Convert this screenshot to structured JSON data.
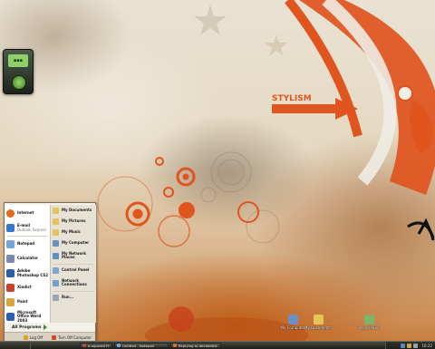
{
  "colors": {
    "accent": "#e0541e",
    "taskbar": "#2a2a25",
    "menu_bg": "#f4f1ea"
  },
  "wallpaper": {
    "text": "STYLISM"
  },
  "start_menu": {
    "pinned": [
      {
        "title": "Internet",
        "sub": "",
        "icon": "browser-icon",
        "color": "#e66a1b"
      },
      {
        "title": "E-mail",
        "sub": "Outlook Express",
        "icon": "mail-icon",
        "color": "#3a77c9"
      }
    ],
    "recent": [
      {
        "title": "Notepad",
        "icon": "notepad-icon",
        "color": "#6fa7d8"
      },
      {
        "title": "Calculator",
        "icon": "calculator-icon",
        "color": "#7b8aa8"
      },
      {
        "title": "Adobe Photoshop CS2",
        "icon": "photoshop-icon",
        "color": "#2a5fa8"
      },
      {
        "title": "Xindict",
        "icon": "dictionary-icon",
        "color": "#c9432c"
      },
      {
        "title": "Paint",
        "icon": "paint-icon",
        "color": "#d9a63a"
      },
      {
        "title": "Microsoft Office Word 2003",
        "icon": "word-icon",
        "color": "#2f5fb3"
      }
    ],
    "places": [
      {
        "label": "My Documents",
        "icon": "documents-icon",
        "color": "#e6c35a"
      },
      {
        "label": "My Pictures",
        "icon": "pictures-icon",
        "color": "#e6c35a"
      },
      {
        "label": "My Music",
        "icon": "music-icon",
        "color": "#e6c35a"
      },
      {
        "label": "My Computer",
        "icon": "computer-icon",
        "color": "#6d8fc2"
      },
      {
        "label": "My Network Places",
        "icon": "network-icon",
        "color": "#5a8fc8"
      },
      {
        "label": "Control Panel",
        "icon": "control-panel-icon",
        "color": "#7fa6d1"
      },
      {
        "label": "Network Connections",
        "icon": "connections-icon",
        "color": "#6fa0cf"
      },
      {
        "label": "Run...",
        "icon": "run-icon",
        "color": "#9aa6b8"
      }
    ],
    "all_programs": "All Programs",
    "log_off": "Log Off",
    "turn_off": "Turn Off Computer"
  },
  "desktop_icons": [
    {
      "label": "My Computer",
      "icon": "computer-icon",
      "color": "#6d8fc2"
    },
    {
      "label": "My Documents",
      "icon": "documents-icon",
      "color": "#e6c35a"
    },
    {
      "label": "Recycle Bin",
      "icon": "recycle-bin-icon",
      "color": "#7ab56a"
    }
  ],
  "taskbar": {
    "items": [
      {
        "label": "e-squared Free 2.5",
        "icon": "app-icon",
        "color": "#b24a3a"
      },
      {
        "label": "Untitled - Notepad",
        "icon": "notepad-icon",
        "color": "#6fa7d8"
      },
      {
        "label": "Replying to deviantArt...",
        "icon": "browser-icon",
        "color": "#e66a1b"
      }
    ],
    "clock": "16:22"
  }
}
